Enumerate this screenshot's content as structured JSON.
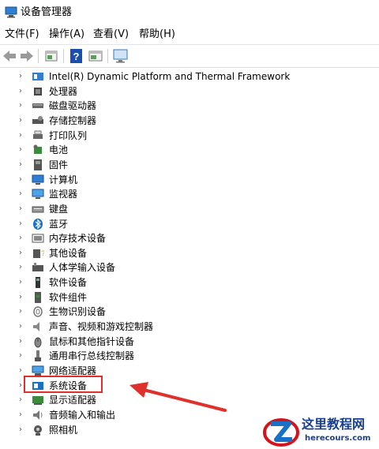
{
  "window": {
    "title": "设备管理器"
  },
  "menubar": {
    "items": [
      "文件(F)",
      "操作(A)",
      "查看(V)",
      "帮助(H)"
    ]
  },
  "toolbar": {
    "buttons": [
      "back-icon",
      "forward-icon",
      "properties-icon",
      "help-icon",
      "view-icon",
      "monitor-icon"
    ]
  },
  "tree": {
    "items": [
      {
        "label": "Intel(R) Dynamic Platform and Thermal Framework",
        "icon": "thermal-icon"
      },
      {
        "label": "处理器",
        "icon": "cpu-icon"
      },
      {
        "label": "磁盘驱动器",
        "icon": "disk-icon"
      },
      {
        "label": "存储控制器",
        "icon": "storage-controller-icon"
      },
      {
        "label": "打印队列",
        "icon": "printer-icon"
      },
      {
        "label": "电池",
        "icon": "battery-icon"
      },
      {
        "label": "固件",
        "icon": "firmware-icon"
      },
      {
        "label": "计算机",
        "icon": "computer-icon"
      },
      {
        "label": "监视器",
        "icon": "monitor-icon"
      },
      {
        "label": "键盘",
        "icon": "keyboard-icon"
      },
      {
        "label": "蓝牙",
        "icon": "bluetooth-icon"
      },
      {
        "label": "内存技术设备",
        "icon": "memory-icon"
      },
      {
        "label": "其他设备",
        "icon": "other-device-icon"
      },
      {
        "label": "人体学输入设备",
        "icon": "hid-icon"
      },
      {
        "label": "软件设备",
        "icon": "software-device-icon"
      },
      {
        "label": "软件组件",
        "icon": "software-component-icon"
      },
      {
        "label": "生物识别设备",
        "icon": "biometric-icon"
      },
      {
        "label": "声音、视频和游戏控制器",
        "icon": "sound-icon"
      },
      {
        "label": "鼠标和其他指针设备",
        "icon": "mouse-icon"
      },
      {
        "label": "通用串行总线控制器",
        "icon": "usb-icon"
      },
      {
        "label": "网络适配器",
        "icon": "network-icon"
      },
      {
        "label": "系统设备",
        "icon": "system-device-icon",
        "highlighted": true
      },
      {
        "label": "显示适配器",
        "icon": "display-adapter-icon"
      },
      {
        "label": "音频输入和输出",
        "icon": "audio-io-icon"
      },
      {
        "label": "照相机",
        "icon": "camera-icon"
      }
    ]
  },
  "watermark": {
    "name": "这里教程网",
    "url": "herecours.com"
  },
  "colors": {
    "highlight": "#e0302b",
    "accent": "#1a6fc7",
    "watermark_red": "#d4141c"
  }
}
